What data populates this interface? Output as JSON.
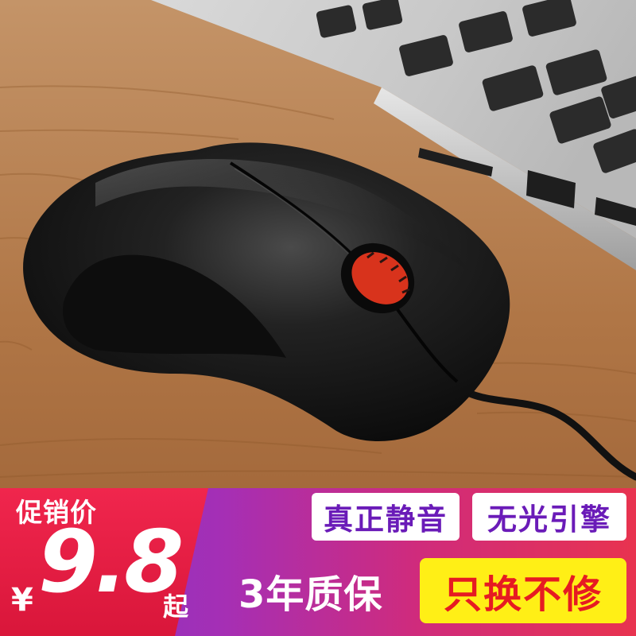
{
  "promo": {
    "label": "促销价",
    "currency": "¥",
    "price": "9.8",
    "price_suffix": "起"
  },
  "features": {
    "silent": "真正静音",
    "engine": "无光引擎",
    "warranty": "3年质保",
    "exchange": "只换不修"
  },
  "colors": {
    "price_panel": "#e01e44",
    "bar_gradient_start": "#7a33c9",
    "bar_gradient_end": "#e8334f",
    "feature_text": "#6a1bb8",
    "exchange_bg": "#ffef16",
    "exchange_text": "#e61b22",
    "mouse_body": "#141414",
    "scroll_wheel": "#d8331c",
    "desk": "#a36a3d"
  }
}
